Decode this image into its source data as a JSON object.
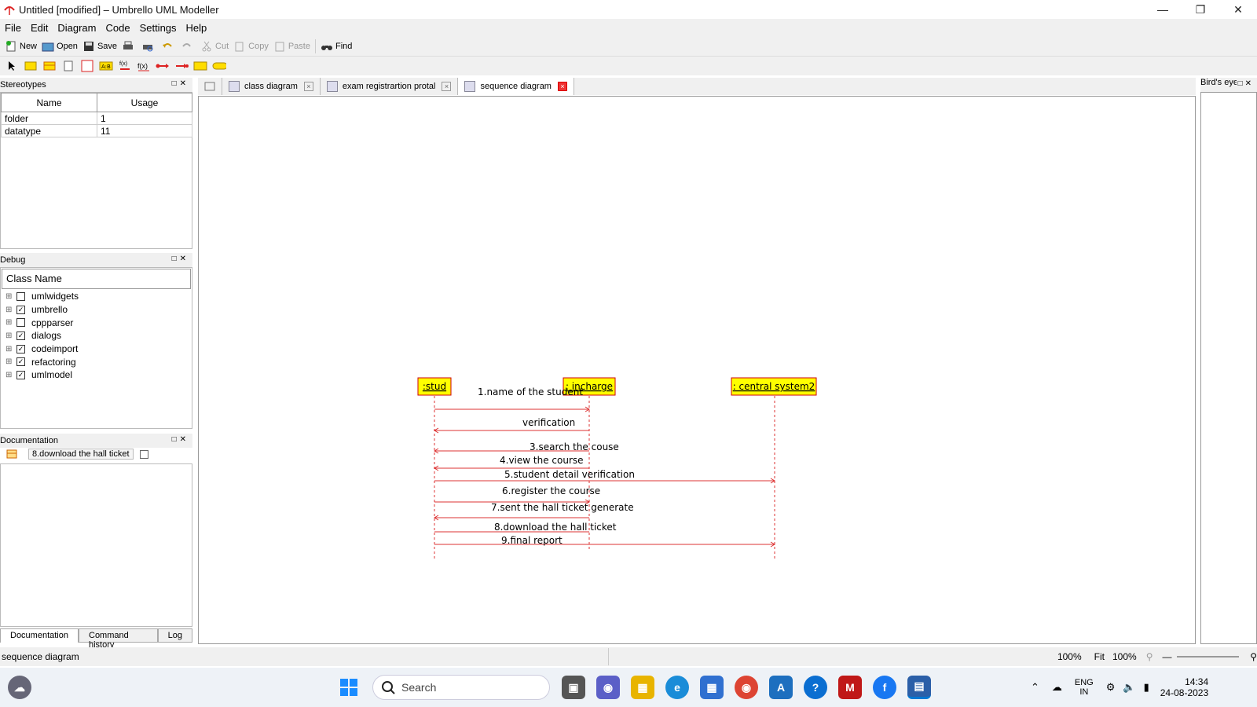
{
  "window": {
    "title": "Untitled [modified] – Umbrello UML Modeller",
    "minimize": "—",
    "restore": "❐",
    "close": "✕"
  },
  "menu": [
    "File",
    "Edit",
    "Diagram",
    "Code",
    "Settings",
    "Help"
  ],
  "toolbar": {
    "new": "New",
    "open": "Open",
    "save": "Save",
    "cut": "Cut",
    "copy": "Copy",
    "paste": "Paste",
    "find": "Find"
  },
  "stereotypes": {
    "title": "Stereotypes",
    "columns": [
      "Name",
      "Usage"
    ],
    "rows": [
      {
        "name": "folder",
        "usage": "1"
      },
      {
        "name": "datatype",
        "usage": "11"
      }
    ]
  },
  "debug": {
    "title": "Debug",
    "column": "Class Name",
    "items": [
      {
        "name": "umlwidgets",
        "checked": false
      },
      {
        "name": "umbrello",
        "checked": true
      },
      {
        "name": "cppparser",
        "checked": false
      },
      {
        "name": "dialogs",
        "checked": true
      },
      {
        "name": "codeimport",
        "checked": true
      },
      {
        "name": "refactoring",
        "checked": true
      },
      {
        "name": "umlmodel",
        "checked": true
      }
    ]
  },
  "documentation": {
    "title": "Documentation",
    "field": "8.download the hall ticket"
  },
  "bottom_tabs": [
    "Documentation",
    "Command history",
    "Log"
  ],
  "tabs": [
    {
      "label": "class diagram",
      "active": false
    },
    {
      "label": "exam registrartion protal",
      "active": false
    },
    {
      "label": "sequence diagram",
      "active": true
    }
  ],
  "birds_eye": {
    "title": "Bird's eye"
  },
  "diagram": {
    "lifelines": [
      ":stud",
      ": incharge",
      ": central system2"
    ],
    "messages": [
      "1.name of the student",
      "verification",
      "3.search the couse",
      "4.view the course",
      "5.student detail verification",
      "6.register the course",
      "7.sent the hall ticket generate",
      "8.download the hall ticket",
      "9.final report"
    ]
  },
  "status": {
    "text": "sequence diagram",
    "zoom1": "100%",
    "fit": "Fit",
    "zoom2": "100%"
  },
  "taskbar": {
    "search": "Search",
    "lang1": "ENG",
    "lang2": "IN",
    "time": "14:34",
    "date": "24-08-2023"
  },
  "colors": {
    "accent": "#e33b3b",
    "note": "#ffff00",
    "taskbar_blue": "#0078d4"
  }
}
